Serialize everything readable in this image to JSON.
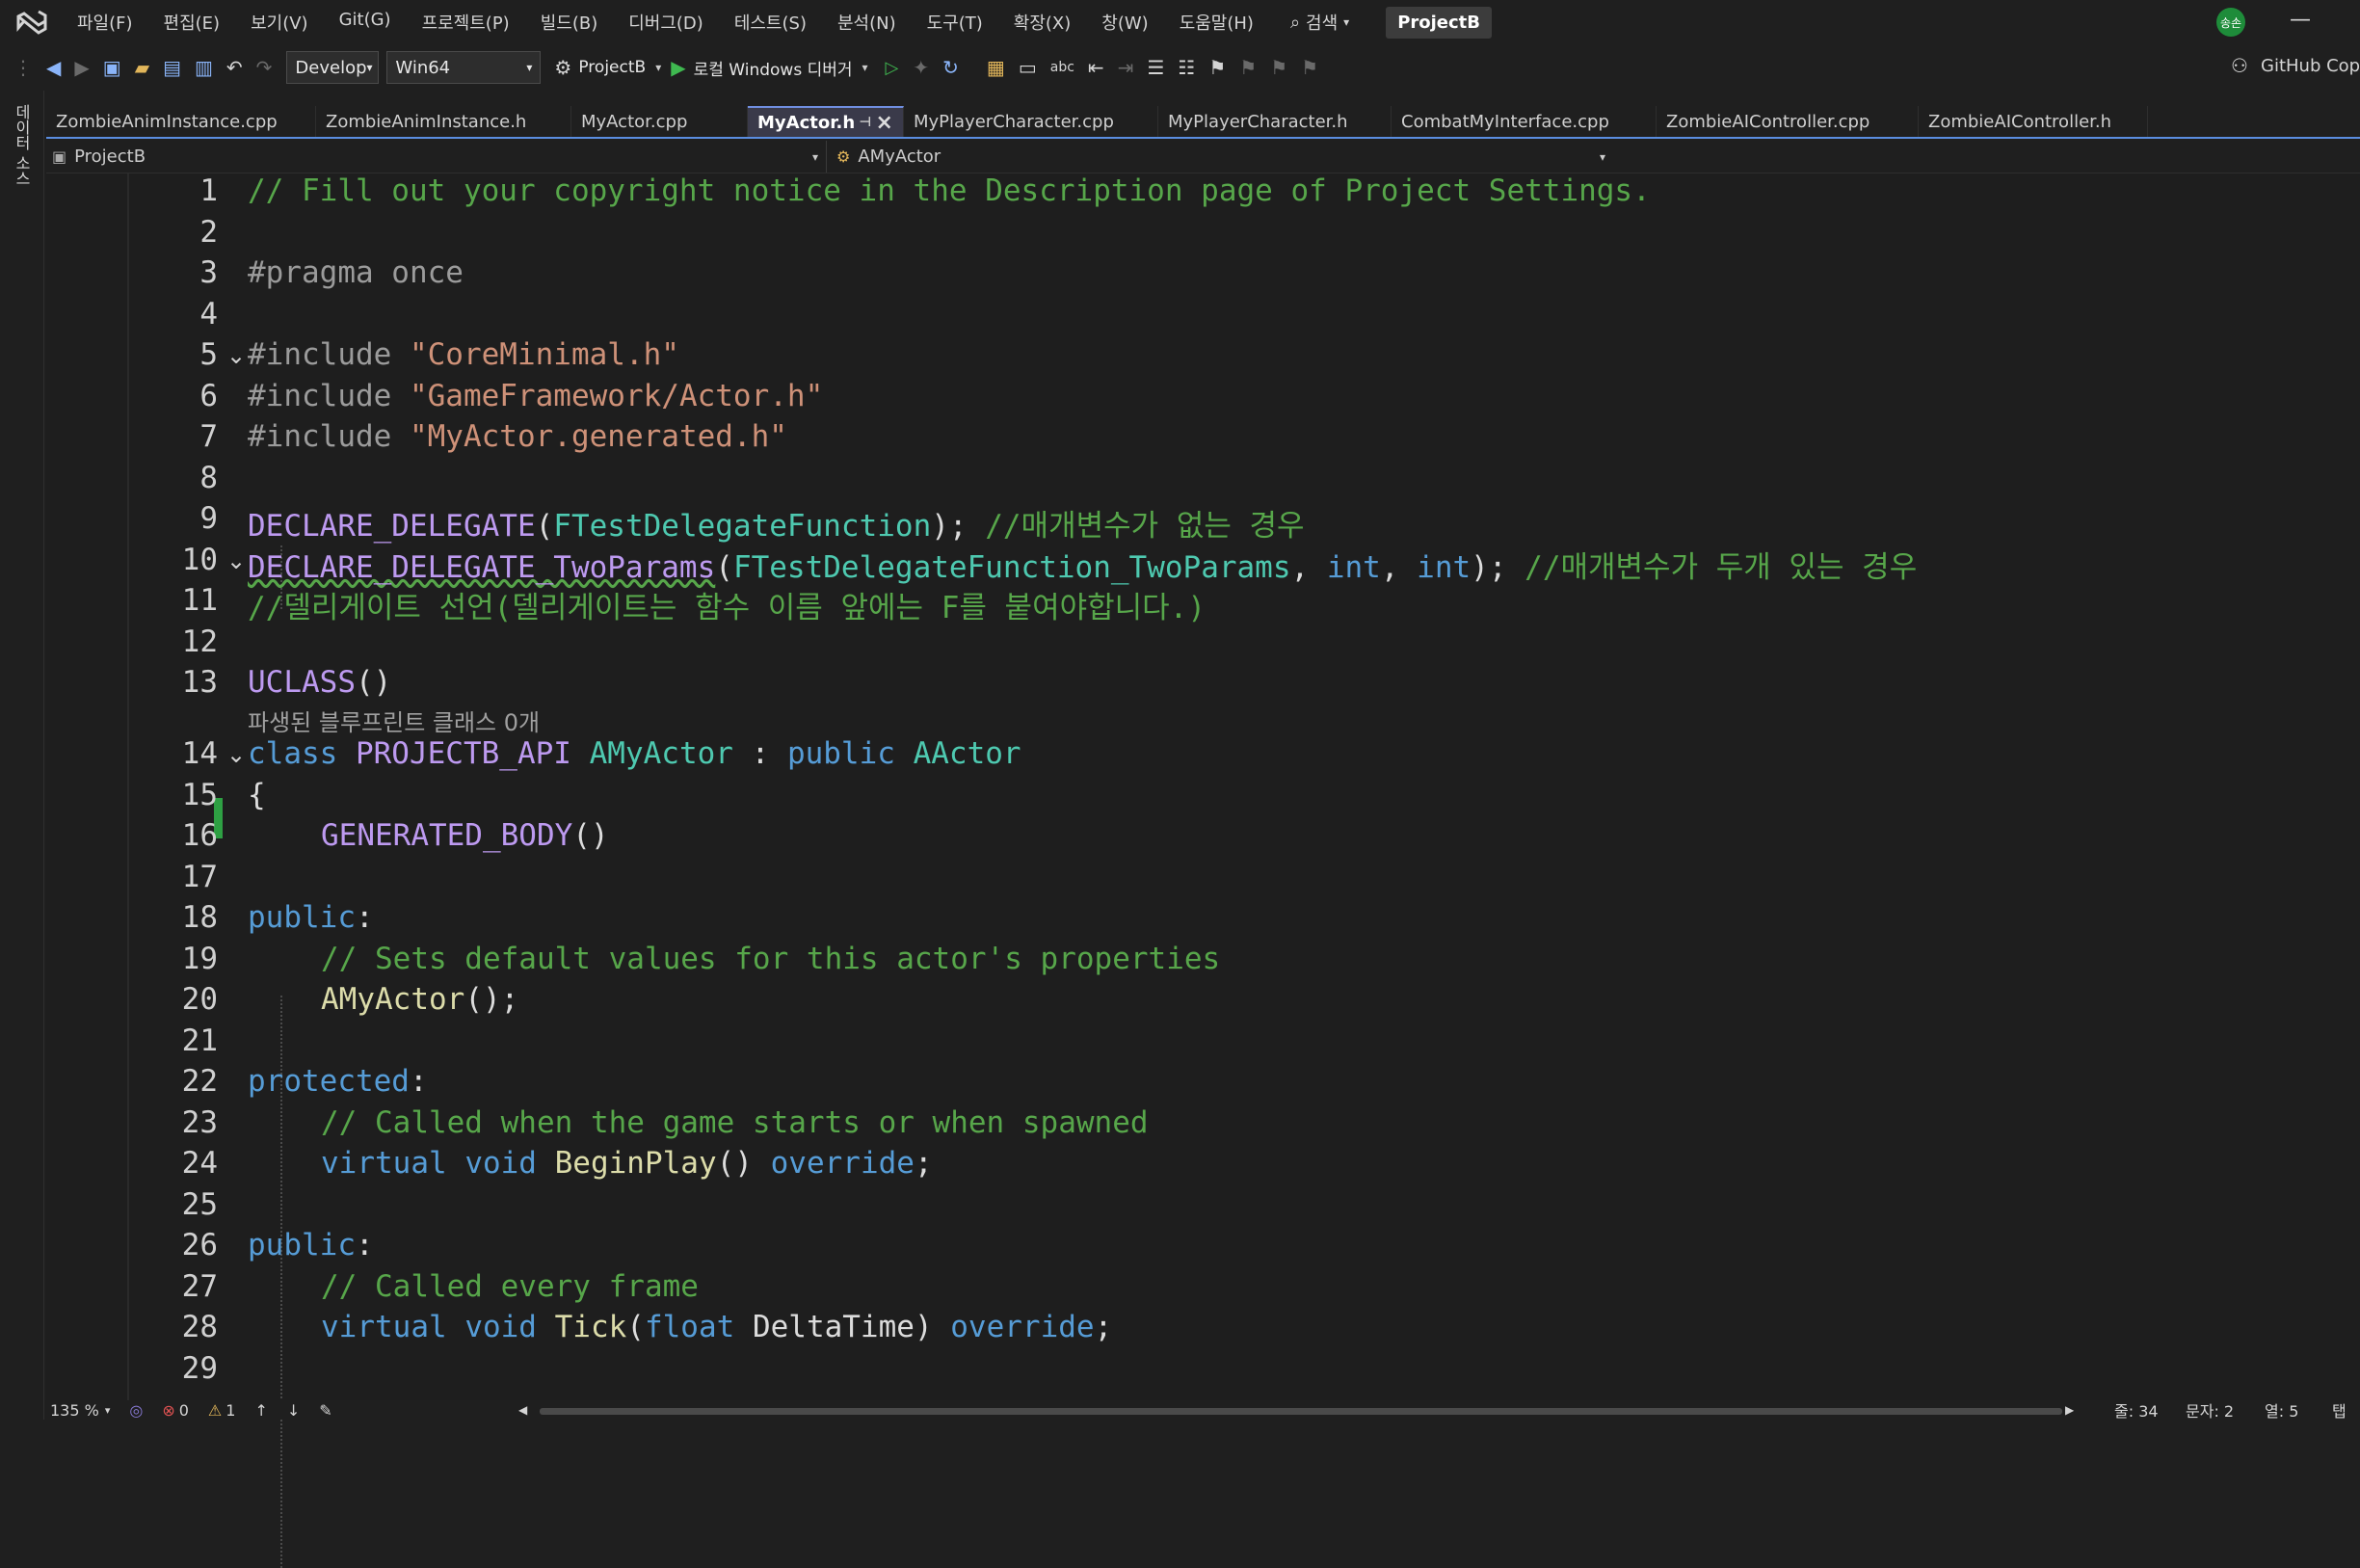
{
  "menu": {
    "items": [
      "파일(F)",
      "편집(E)",
      "보기(V)",
      "Git(G)",
      "프로젝트(P)",
      "빌드(B)",
      "디버그(D)",
      "테스트(S)",
      "분석(N)",
      "도구(T)",
      "확장(X)",
      "창(W)",
      "도움말(H)"
    ],
    "search_label": "검색",
    "project_badge": "ProjectB",
    "user_avatar": "송손"
  },
  "toolbar": {
    "config": "Develop",
    "platform": "Win64",
    "startup_project": "ProjectB",
    "debug_target": "로컬 Windows 디버거",
    "copilot": "GitHub Copi"
  },
  "side_panel": {
    "label": "데이터 소스"
  },
  "tabs": [
    {
      "label": "ZombieAnimInstance.cpp",
      "active": false
    },
    {
      "label": "ZombieAnimInstance.h",
      "active": false
    },
    {
      "label": "MyActor.cpp",
      "active": false
    },
    {
      "label": "MyActor.h",
      "active": true
    },
    {
      "label": "MyPlayerCharacter.cpp",
      "active": false
    },
    {
      "label": "MyPlayerCharacter.h",
      "active": false
    },
    {
      "label": "CombatMyInterface.cpp",
      "active": false
    },
    {
      "label": "ZombieAIController.cpp",
      "active": false
    },
    {
      "label": "ZombieAIController.h",
      "active": false
    }
  ],
  "nav": {
    "project": "ProjectB",
    "scope": "AMyActor"
  },
  "hint": "파생된 블루프린트 클래스 0개",
  "lines": [
    "1",
    "2",
    "3",
    "4",
    "5",
    "6",
    "7",
    "8",
    "9",
    "10",
    "11",
    "12",
    "13",
    "14",
    "15",
    "16",
    "17",
    "18",
    "19",
    "20",
    "21",
    "22",
    "23",
    "24",
    "25",
    "26",
    "27",
    "28",
    "29"
  ],
  "code": {
    "l1": "// Fill out your copyright notice in the Description page of Project Settings.",
    "l3": "#pragma once",
    "l5a": "#include ",
    "l5b": "\"CoreMinimal.h\"",
    "l6a": "#include ",
    "l6b": "\"GameFramework/Actor.h\"",
    "l7a": "#include ",
    "l7b": "\"MyActor.generated.h\"",
    "l9a": "DECLARE_DELEGATE",
    "l9b": "(",
    "l9c": "FTestDelegateFunction",
    "l9d": "); ",
    "l9e": "//매개변수가 없는 경우",
    "l10a": "DECLARE_DELEGATE_TwoParams",
    "l10b": "(",
    "l10c": "FTestDelegateFunction_TwoParams",
    "l10d": ", ",
    "l10e": "int",
    "l10f": ", ",
    "l10g": "int",
    "l10h": "); ",
    "l10i": "//매개변수가 두개 있는 경우",
    "l11": "//델리게이트 선언(델리게이트는 함수 이름 앞에는 F를 붙여야합니다.)",
    "l13a": "UCLASS",
    "l13b": "()",
    "l14a": "class ",
    "l14b": "PROJECTB_API ",
    "l14c": "AMyActor",
    "l14d": " : ",
    "l14e": "public ",
    "l14f": "AActor",
    "l15": "{",
    "l16a": "GENERATED_BODY",
    "l16b": "()",
    "l18a": "public",
    "l18b": ":",
    "l19": "// Sets default values for this actor's properties",
    "l20a": "AMyActor",
    "l20b": "();",
    "l22a": "protected",
    "l22b": ":",
    "l23": "// Called when the game starts or when spawned",
    "l24a": "virtual ",
    "l24b": "void ",
    "l24c": "BeginPlay",
    "l24d": "() ",
    "l24e": "override",
    "l24f": ";",
    "l26a": "public",
    "l26b": ":",
    "l27": "// Called every frame",
    "l28a": "virtual ",
    "l28b": "void ",
    "l28c": "Tick",
    "l28d": "(",
    "l28e": "float ",
    "l28f": "DeltaTime",
    "l28g": ") ",
    "l28h": "override",
    "l28i": ";"
  },
  "status": {
    "zoom": "135 %",
    "errors": "0",
    "warnings": "1",
    "line": "줄: 34",
    "char": "문자: 2",
    "col": "열: 5",
    "tab": "탭"
  }
}
